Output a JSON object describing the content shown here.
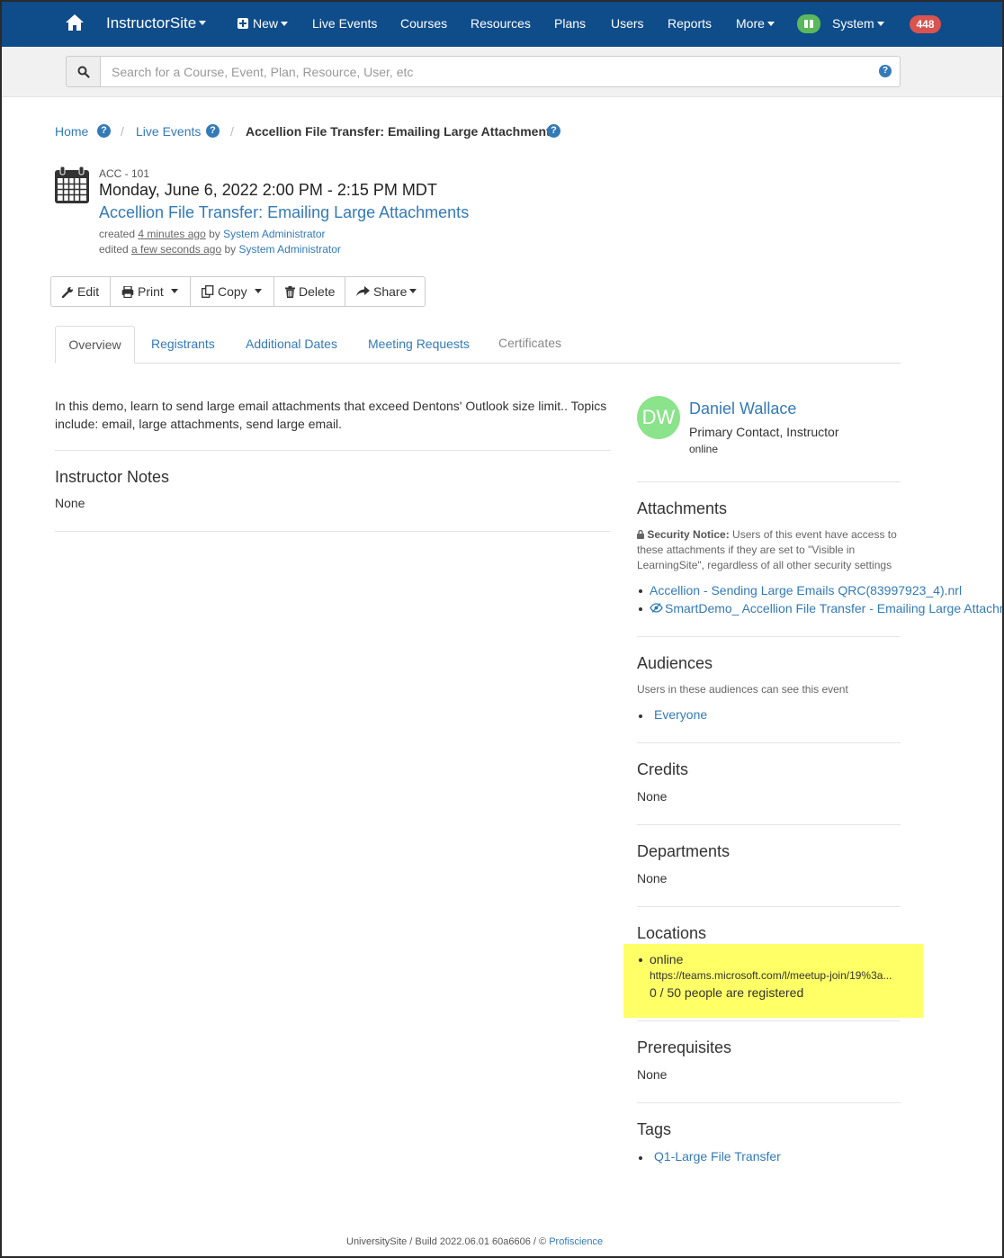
{
  "nav": {
    "brand": "InstructorSite",
    "new": "New",
    "live_events": "Live Events",
    "courses": "Courses",
    "resources": "Resources",
    "plans": "Plans",
    "users": "Users",
    "reports": "Reports",
    "more": "More",
    "system": "System",
    "badge_count": "448"
  },
  "search": {
    "placeholder": "Search for a Course, Event, Plan, Resource, User, etc",
    "help": "?"
  },
  "breadcrumb": {
    "home": "Home",
    "live_events": "Live Events",
    "current": "Accellion File Transfer: Emailing Large Attachments",
    "sep": "/",
    "help": "?"
  },
  "event": {
    "code": "ACC - 101",
    "datetime": "Monday, June 6, 2022 2:00 PM - 2:15 PM MDT",
    "title": "Accellion File Transfer: Emailing Large Attachments",
    "created_prefix": "created",
    "created_ago": "4 minutes ago",
    "by": "by",
    "created_by": "System Administrator",
    "edited_prefix": "edited",
    "edited_ago": "a few seconds ago",
    "edited_by": "System Administrator"
  },
  "toolbar": {
    "edit": "Edit",
    "print": "Print",
    "copy": "Copy",
    "delete": "Delete",
    "share": "Share"
  },
  "tabs": {
    "overview": "Overview",
    "registrants": "Registrants",
    "additional_dates": "Additional Dates",
    "meeting_requests": "Meeting Requests",
    "certificates": "Certificates"
  },
  "overview": {
    "description_line1": "In this demo, learn to send large email attachments that exceed Dentons' Outlook size limit.. Topics",
    "description_line2": "include: email, large attachments, send large email.",
    "notes_heading": "Instructor Notes",
    "notes_value": "None"
  },
  "contact": {
    "initials": "DW",
    "name": "Daniel Wallace",
    "role": "Primary Contact, Instructor",
    "status": "online"
  },
  "attachments": {
    "heading": "Attachments",
    "notice_label": "Security Notice:",
    "notice_line1": "Users of this event have access to",
    "notice_line2": "these attachments if they are set to \"Visible in",
    "notice_line3": "LearningSite\", regardless of all other security settings",
    "items": [
      "Accellion - Sending Large Emails QRC(83997923_4).nrl",
      "SmartDemo_ Accellion File Transfer - Emailing Large Attachments"
    ]
  },
  "audiences": {
    "heading": "Audiences",
    "note": "Users in these audiences can see this event",
    "items": [
      "Everyone"
    ]
  },
  "credits": {
    "heading": "Credits",
    "value": "None"
  },
  "departments": {
    "heading": "Departments",
    "value": "None"
  },
  "locations": {
    "heading": "Locations",
    "name": "online",
    "url": "https://teams.microsoft.com/l/meetup-join/19%3a...",
    "registered": "0 / 50 people are registered"
  },
  "prerequisites": {
    "heading": "Prerequisites",
    "value": "None"
  },
  "tags": {
    "heading": "Tags",
    "items": [
      "Q1-Large File Transfer"
    ]
  },
  "footer": {
    "text": "UniversitySite / Build 2022.06.01 60a6606 / ©",
    "link": "Profiscience"
  }
}
